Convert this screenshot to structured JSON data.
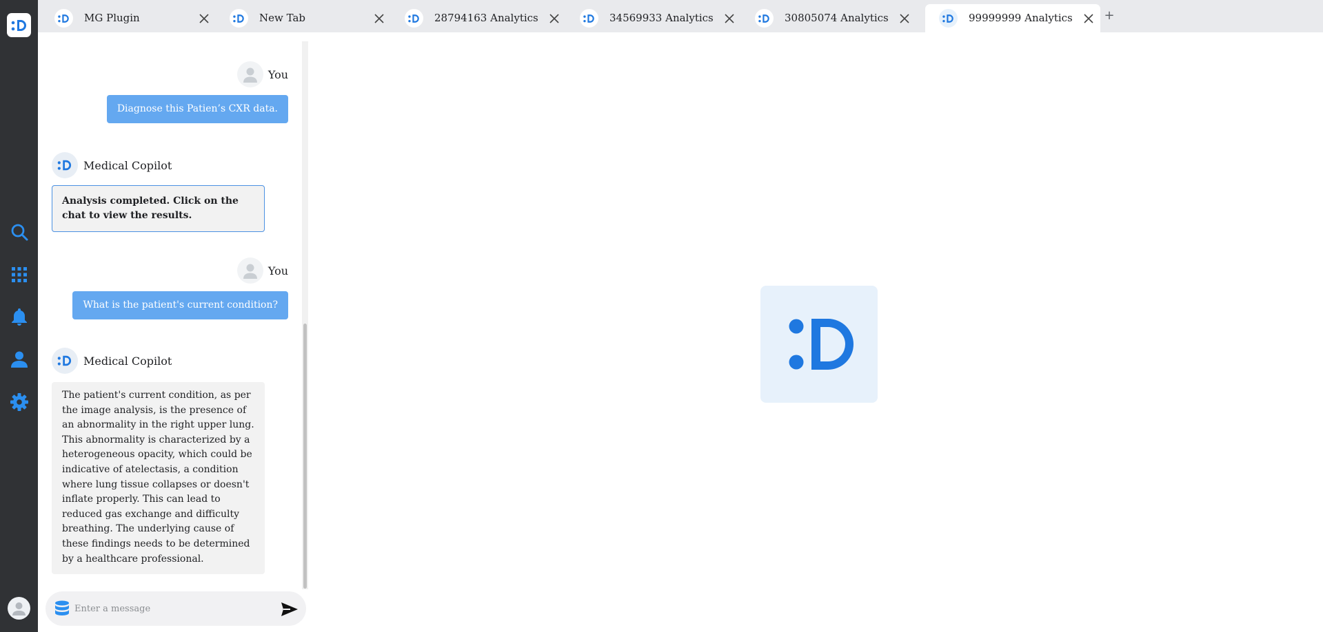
{
  "colors": {
    "brand": "#1f78e0",
    "rail_bg": "#303235",
    "user_bubble": "#64a8f0",
    "bot_bubble": "#f2f2f2",
    "alert_border": "#4a90e2"
  },
  "rail": {
    "logo_icon": "brand-logo-icon",
    "items": [
      {
        "name": "search",
        "icon": "search-icon"
      },
      {
        "name": "apps",
        "icon": "apps-grid-icon"
      },
      {
        "name": "notifications",
        "icon": "bell-icon"
      },
      {
        "name": "profile",
        "icon": "user-icon"
      },
      {
        "name": "settings",
        "icon": "gear-icon"
      }
    ],
    "avatar_icon": "avatar-icon"
  },
  "tabs": [
    {
      "title": "MG Plugin",
      "active": false
    },
    {
      "title": "New Tab",
      "active": false
    },
    {
      "title": "28794163 Analytics",
      "active": false
    },
    {
      "title": "34569933 Analytics",
      "active": false
    },
    {
      "title": "30805074 Analytics",
      "active": false
    },
    {
      "title": "99999999 Analytics",
      "active": true
    }
  ],
  "new_tab_label": "+",
  "chat": {
    "messages": [
      {
        "role": "user",
        "sender": "You",
        "text": "Diagnose this Patien’s CXR data."
      },
      {
        "role": "assistant",
        "sender": "Medical Copilot",
        "text": "Analysis completed. Click on the chat to view the results."
      },
      {
        "role": "user",
        "sender": "You",
        "text": "What is the patient's current condition?"
      },
      {
        "role": "assistant",
        "sender": "Medical Copilot",
        "text": "The patient's current condition, as per the image analysis, is the presence of an abnormality in the right upper lung. This abnormality is characterized by a heterogeneous opacity, which could be indicative of atelectasis, a condition where lung tissue collapses or doesn't inflate properly. This can lead to reduced gas exchange and difficulty breathing. The underlying cause of these findings needs to be determined by a healthcare professional."
      }
    ],
    "composer": {
      "placeholder": "Enter a message",
      "value": "",
      "left_icon": "database-icon",
      "send_icon": "send-icon"
    }
  },
  "main": {
    "center_icon": "brand-logo-icon"
  }
}
